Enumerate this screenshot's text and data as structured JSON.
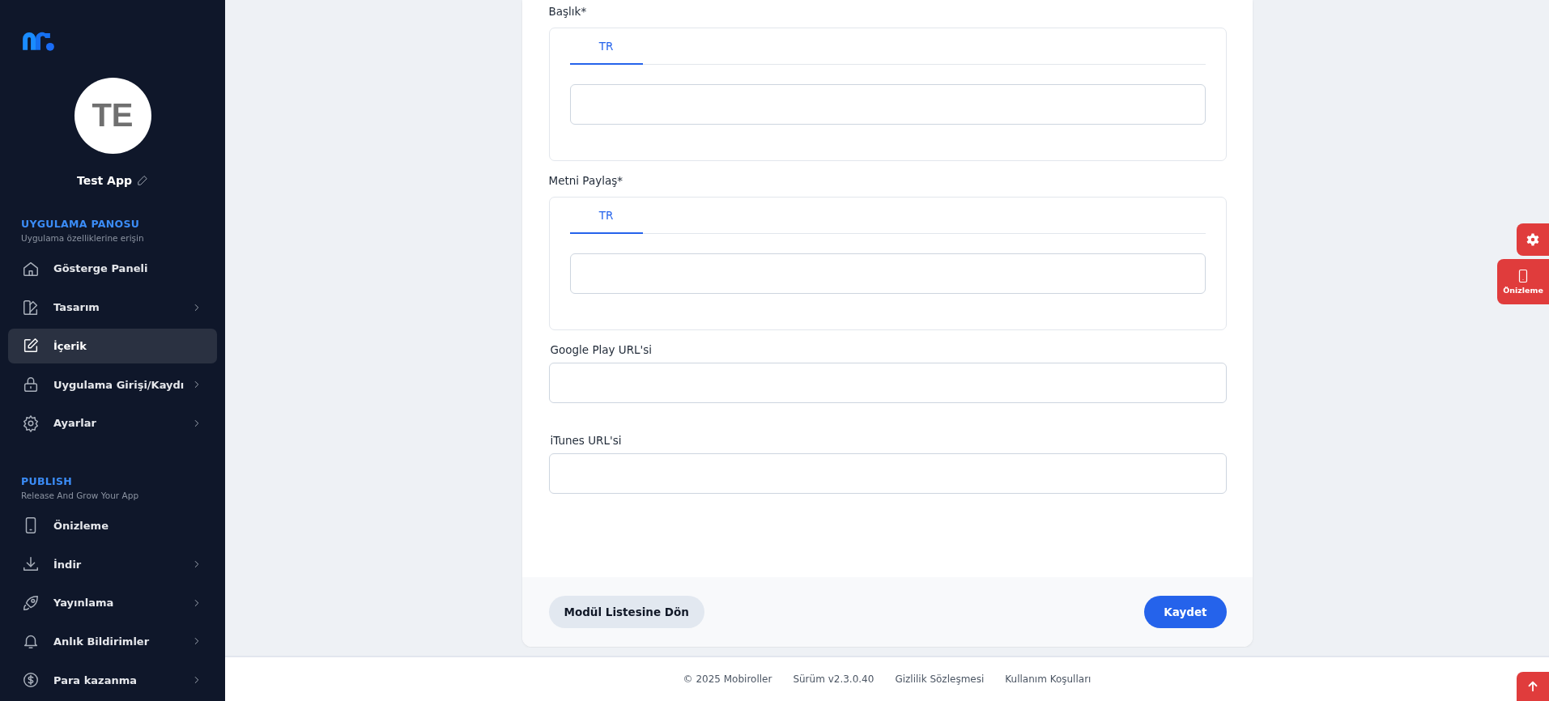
{
  "sidebar": {
    "avatar": {
      "initials": "TE"
    },
    "app_name": "Test App",
    "sections": [
      {
        "title": "UYGULAMA PANOSU",
        "subtitle": "Uygulama özelliklerine erişin",
        "items": [
          {
            "label": "Gösterge Paneli",
            "expandable": false,
            "selected": false
          },
          {
            "label": "Tasarım",
            "expandable": true,
            "selected": false
          },
          {
            "label": "İçerik",
            "expandable": false,
            "selected": true
          },
          {
            "label": "Uygulama Girişi/Kaydı",
            "expandable": true,
            "selected": false
          },
          {
            "label": "Ayarlar",
            "expandable": true,
            "selected": false
          }
        ]
      },
      {
        "title": "PUBLISH",
        "subtitle": "Release And Grow Your App",
        "items": [
          {
            "label": "Önizleme",
            "expandable": false,
            "selected": false
          },
          {
            "label": "İndir",
            "expandable": true,
            "selected": false
          },
          {
            "label": "Yayınlama",
            "expandable": true,
            "selected": false
          },
          {
            "label": "Anlık Bildirimler",
            "expandable": true,
            "selected": false
          },
          {
            "label": "Para kazanma",
            "expandable": true,
            "selected": false
          }
        ]
      }
    ]
  },
  "form": {
    "fields": [
      {
        "kind": "localized",
        "label": "Başlık*",
        "tabs": [
          {
            "label": "TR",
            "selected": true
          }
        ]
      },
      {
        "kind": "localized",
        "label": "Metni Paylaş*",
        "tabs": [
          {
            "label": "TR",
            "selected": true
          }
        ]
      },
      {
        "kind": "input",
        "label": "Google Play URL'si"
      },
      {
        "kind": "input",
        "label": "iTunes URL'si"
      }
    ],
    "back_button": "Modül Listesine Dön",
    "save_button": "Kaydet"
  },
  "footer": [
    "© 2025 Mobiroller",
    "Sürüm v2.3.0.40",
    "Gizlilik Sözleşmesi",
    "Kullanım Koşulları"
  ],
  "floating": {
    "preview_label": "Önizleme"
  }
}
